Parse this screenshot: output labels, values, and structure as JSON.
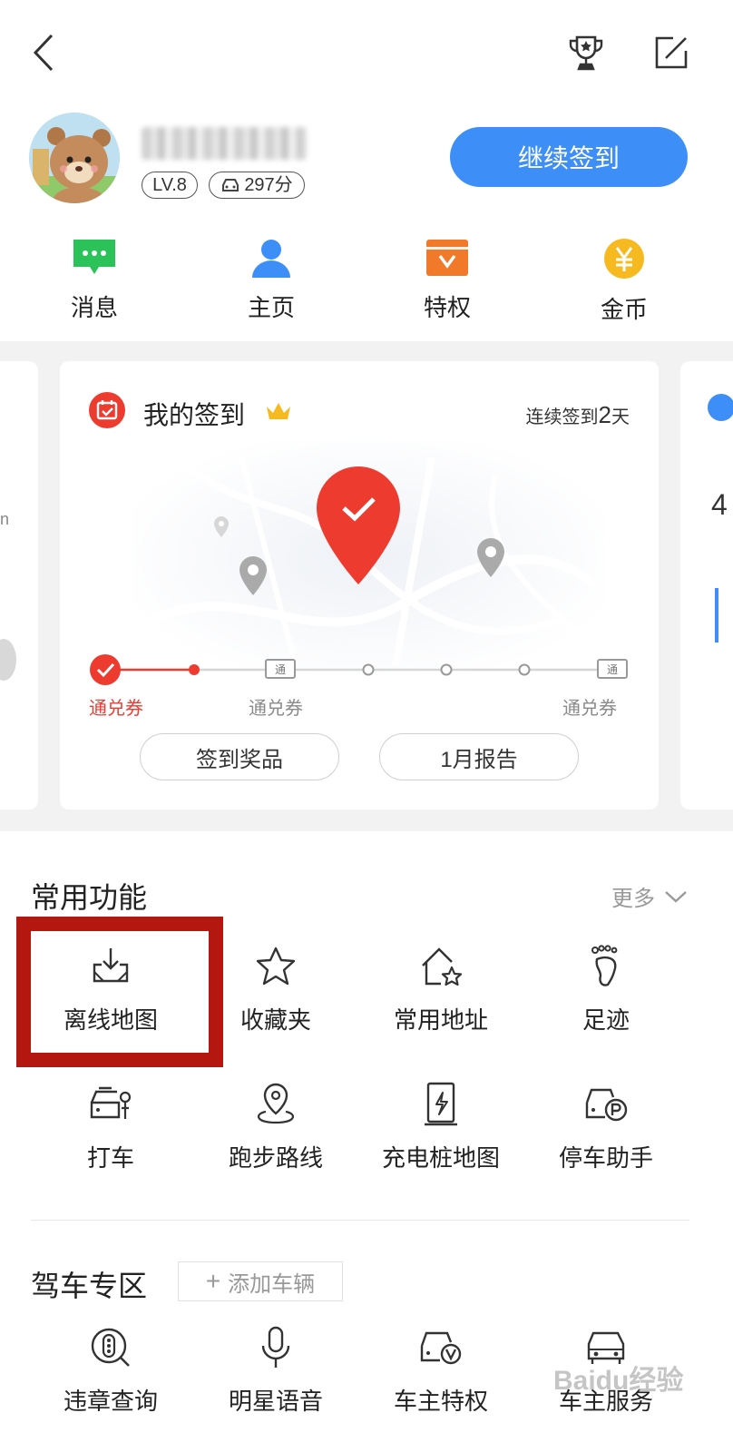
{
  "header": {
    "back_icon": "back-arrow-icon",
    "trophy_icon": "trophy-icon",
    "edit_icon": "edit-icon"
  },
  "profile": {
    "level": "LV.8",
    "points": "297分",
    "checkin_button": "继续签到"
  },
  "quick_nav": [
    {
      "label": "消息",
      "icon": "message-icon",
      "color": "#2bc25a"
    },
    {
      "label": "主页",
      "icon": "user-icon",
      "color": "#3d8ef7"
    },
    {
      "label": "特权",
      "icon": "privilege-icon",
      "color": "#f07a2a"
    },
    {
      "label": "金币",
      "icon": "coin-icon",
      "color": "#f6b91f"
    }
  ],
  "checkin_card": {
    "title": "我的签到",
    "streak_prefix": "连续签到",
    "streak_days": "2",
    "streak_suffix": "天",
    "timeline_labels": [
      "通兑券",
      "通兑券",
      "通兑券"
    ],
    "ticket_text": "通",
    "prize_button": "签到奖品",
    "report_button": "1月报告",
    "colors": {
      "accent": "#ee3b30"
    }
  },
  "common_functions": {
    "title": "常用功能",
    "more": "更多",
    "items": [
      {
        "label": "离线地图",
        "icon": "offline-map-download-icon"
      },
      {
        "label": "收藏夹",
        "icon": "star-icon"
      },
      {
        "label": "常用地址",
        "icon": "home-star-icon"
      },
      {
        "label": "足迹",
        "icon": "footprint-icon"
      },
      {
        "label": "打车",
        "icon": "taxi-icon"
      },
      {
        "label": "跑步路线",
        "icon": "running-route-icon"
      },
      {
        "label": "充电桩地图",
        "icon": "charging-pile-icon"
      },
      {
        "label": "停车助手",
        "icon": "parking-icon"
      }
    ],
    "highlight_color": "#b3170f"
  },
  "driving_zone": {
    "title": "驾车专区",
    "add_vehicle": "添加车辆",
    "items": [
      {
        "label": "违章查询",
        "icon": "violation-query-icon"
      },
      {
        "label": "明星语音",
        "icon": "microphone-icon"
      },
      {
        "label": "车主特权",
        "icon": "car-vip-icon"
      },
      {
        "label": "车主服务",
        "icon": "car-service-icon"
      }
    ]
  },
  "watermark": {
    "text": "Baidu经验"
  }
}
